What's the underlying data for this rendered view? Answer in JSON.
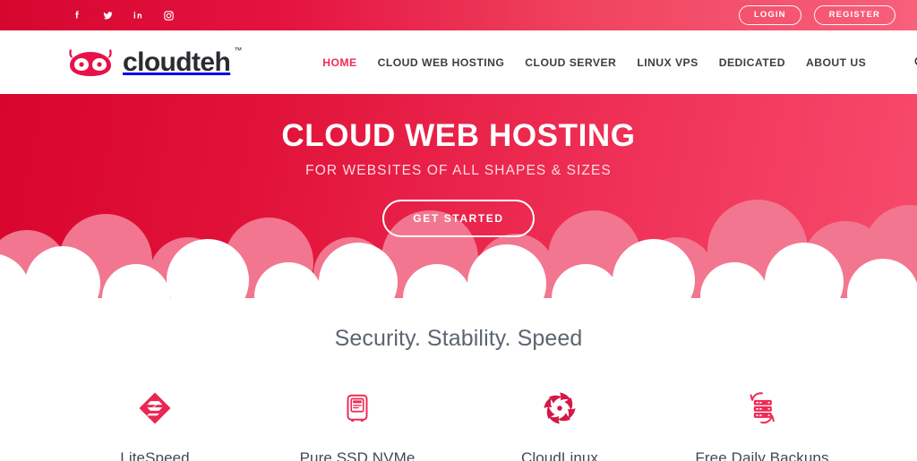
{
  "topbar": {
    "social": [
      {
        "name": "facebook-icon",
        "label": "Facebook"
      },
      {
        "name": "twitter-icon",
        "label": "Twitter"
      },
      {
        "name": "linkedin-icon",
        "label": "LinkedIn"
      },
      {
        "name": "instagram-icon",
        "label": "Instagram"
      }
    ],
    "login_label": "LOGIN",
    "register_label": "REGISTER",
    "gradient_start": "#d5072f",
    "gradient_end": "#f8607c"
  },
  "header": {
    "logo_text": "cloudteh",
    "logo_tm": "™",
    "logo_icon": "owl-logo-icon",
    "search_icon": "search-icon",
    "nav": [
      {
        "label": "HOME",
        "active": true
      },
      {
        "label": "CLOUD WEB HOSTING",
        "active": false
      },
      {
        "label": "CLOUD SERVER",
        "active": false
      },
      {
        "label": "LINUX VPS",
        "active": false
      },
      {
        "label": "DEDICATED",
        "active": false
      },
      {
        "label": "ABOUT US",
        "active": false
      }
    ]
  },
  "hero": {
    "title": "CLOUD WEB HOSTING",
    "subtitle": "FOR WEBSITES OF ALL SHAPES & SIZES",
    "cta_label": "GET STARTED",
    "bg_gradient_start": "#d8052f",
    "bg_gradient_end": "#f74b6c",
    "cloud_back_color": "#f2768f",
    "cloud_front_color": "#ffffff"
  },
  "features": {
    "section_title": "Security. Stability. Speed",
    "items": [
      {
        "label": "LiteSpeed",
        "icon": "litespeed-icon",
        "color": "#e8204c"
      },
      {
        "label": "Pure SSD NVMe",
        "icon": "ssd-drive-icon",
        "color": "#ef2a55"
      },
      {
        "label": "CloudLinux",
        "icon": "cloudlinux-icon",
        "color": "#d61846"
      },
      {
        "label": "Free Daily Backups",
        "icon": "backup-server-icon",
        "color": "#ef2a55"
      }
    ]
  }
}
